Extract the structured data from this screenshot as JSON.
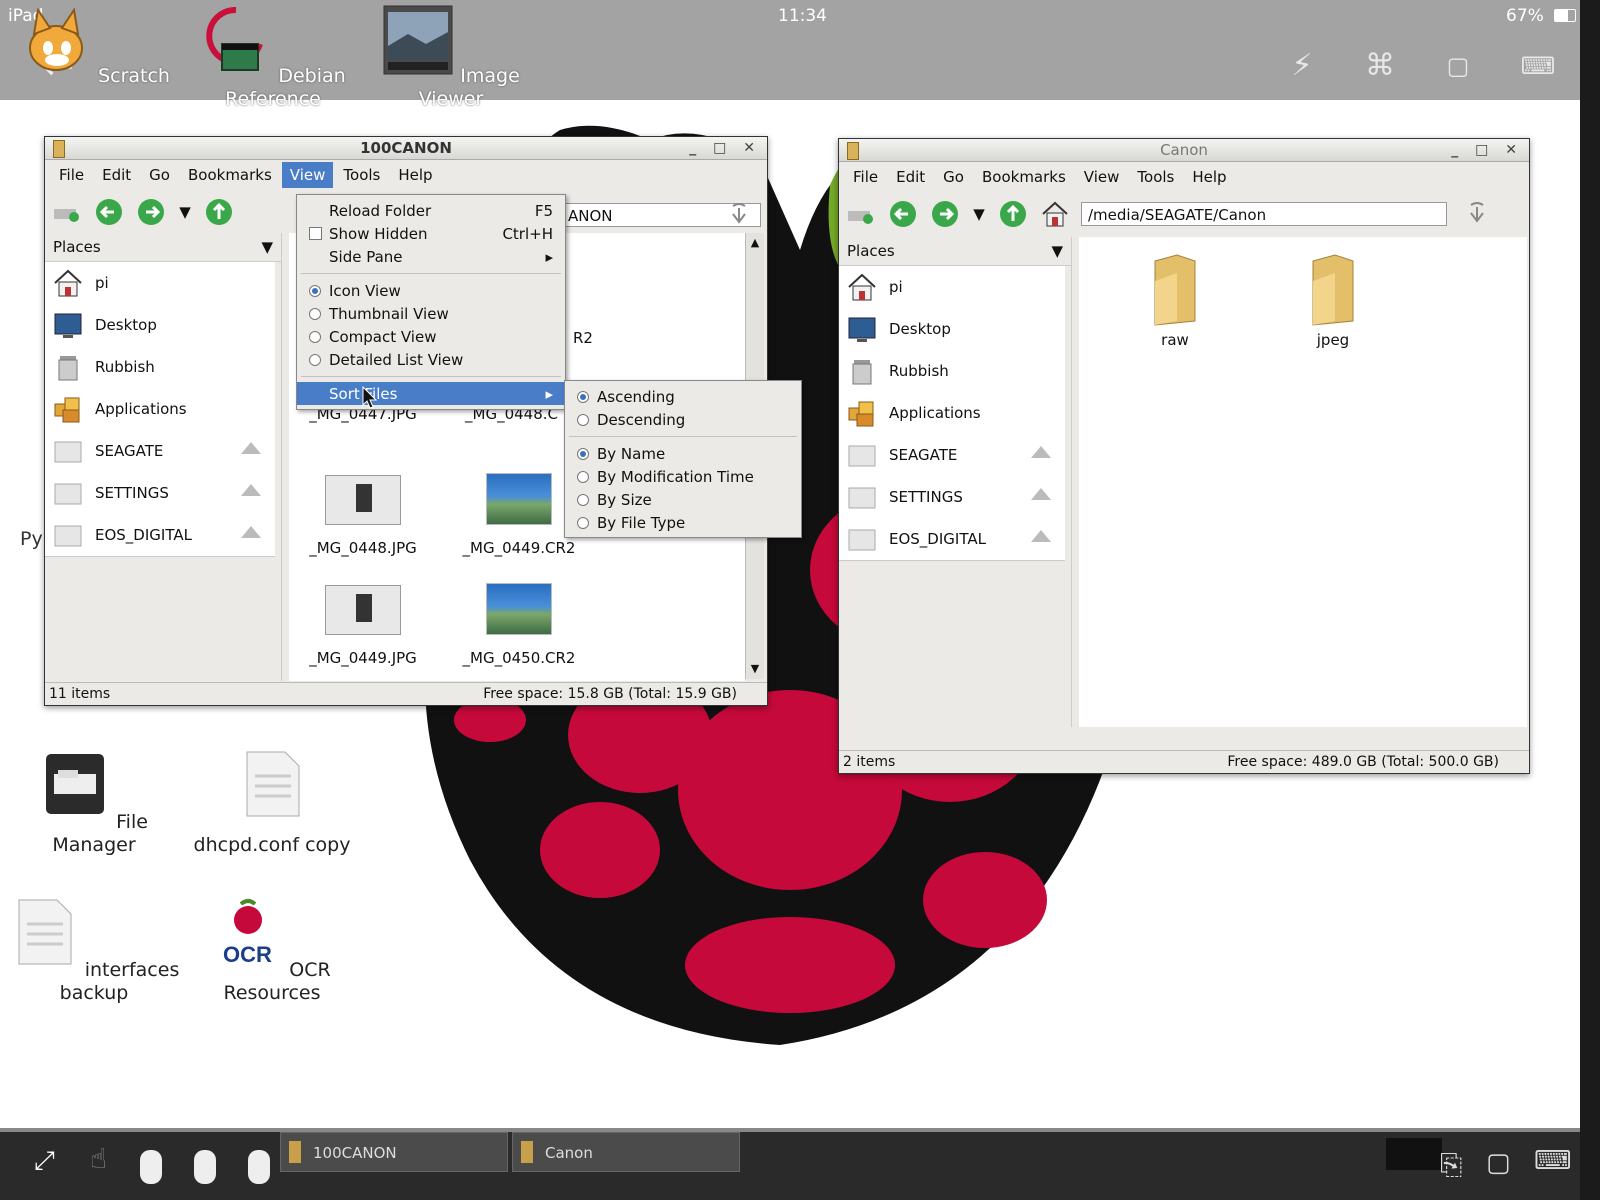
{
  "ios_status": {
    "device": "iPad",
    "time": "11:34",
    "battery": "67%"
  },
  "top_apps": [
    {
      "label": "Scratch",
      "icon": "scratch-cat-icon"
    },
    {
      "label": "Debian Reference",
      "icon": "debian-book-icon"
    },
    {
      "label": "Image Viewer",
      "icon": "image-viewer-icon"
    }
  ],
  "desktop_icons": [
    {
      "label": "File Manager",
      "icon": "file-manager-icon"
    },
    {
      "label": "dhcpd.conf copy",
      "icon": "document-icon"
    },
    {
      "label": "interfaces backup",
      "icon": "document-icon"
    },
    {
      "label": "OCR Resources",
      "icon": "raspberry-ocr-icon"
    },
    {
      "label": "Py",
      "icon": ""
    }
  ],
  "menu_labels": [
    "File",
    "Edit",
    "Go",
    "Bookmarks",
    "View",
    "Tools",
    "Help"
  ],
  "places": {
    "header": "Places",
    "items": [
      {
        "label": "pi",
        "icon": "home-icon"
      },
      {
        "label": "Desktop",
        "icon": "desktop-icon"
      },
      {
        "label": "Rubbish",
        "icon": "trash-icon"
      },
      {
        "label": "Applications",
        "icon": "applications-icon"
      },
      {
        "label": "SEAGATE",
        "icon": "drive-icon"
      },
      {
        "label": "SETTINGS",
        "icon": "drive-icon"
      },
      {
        "label": "EOS_DIGITAL",
        "icon": "drive-icon"
      }
    ]
  },
  "win_left": {
    "title": "100CANON",
    "path_partial": "ANON",
    "status_items": "11 items",
    "status_free": "Free space: 15.8 GB (Total: 15.9 GB)",
    "files": [
      {
        "name": "R2"
      },
      {
        "name": "_MG_0447.JPG"
      },
      {
        "name": "_MG_0448.C"
      },
      {
        "name": "_MG_0448.JPG"
      },
      {
        "name": "_MG_0449.CR2"
      },
      {
        "name": "_MG_0449.JPG"
      },
      {
        "name": "_MG_0450.CR2"
      }
    ]
  },
  "win_right": {
    "title": "Canon",
    "path": "/media/SEAGATE/Canon",
    "status_items": "2 items",
    "status_free": "Free space: 489.0 GB (Total: 500.0 GB)",
    "files": [
      {
        "name": "raw"
      },
      {
        "name": "jpeg"
      }
    ]
  },
  "view_menu": {
    "reload": {
      "label": "Reload Folder",
      "shortcut": "F5"
    },
    "show_hidden": {
      "label": "Show Hidden",
      "shortcut": "Ctrl+H"
    },
    "side_pane": "Side Pane",
    "icon_view": "Icon View",
    "thumbnail_view": "Thumbnail View",
    "compact_view": "Compact View",
    "detailed_view": "Detailed List View",
    "sort_files": "Sort Files"
  },
  "sort_menu": {
    "ascending": "Ascending",
    "descending": "Descending",
    "by_name": "By Name",
    "by_mtime": "By Modification Time",
    "by_size": "By Size",
    "by_type": "By File Type"
  },
  "taskbar": {
    "tasks": [
      "100CANON",
      "Canon"
    ]
  },
  "colors": {
    "raspberry": "#c5093a",
    "leaf": "#75a928",
    "selection": "#4a7dc8"
  }
}
